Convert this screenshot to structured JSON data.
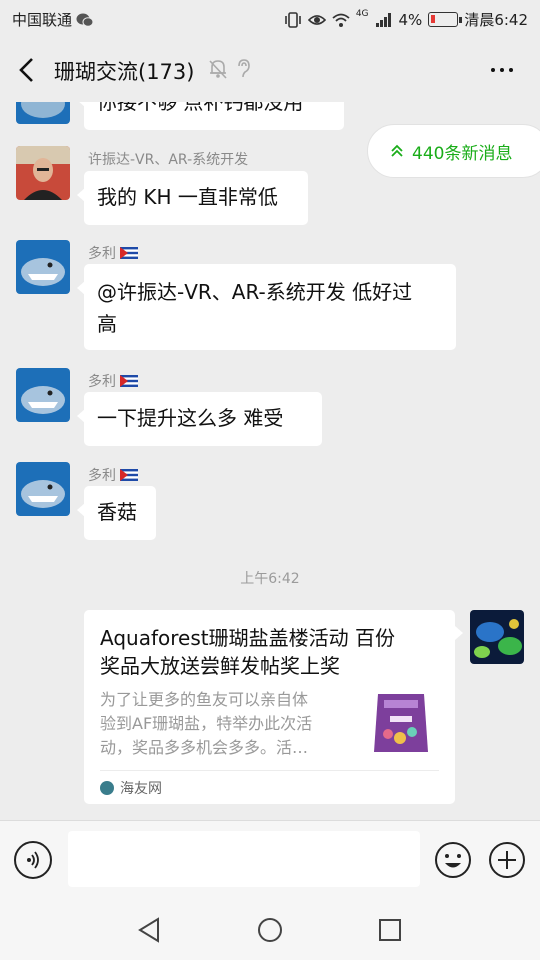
{
  "status_bar": {
    "carrier": "中国联通",
    "network": "4G",
    "battery": "4%",
    "time": "清晨6:42"
  },
  "nav": {
    "title": "珊瑚交流(173)"
  },
  "new_messages": {
    "label": "440条新消息"
  },
  "messages": [
    {
      "text": "你接不够 点补钙都没用"
    },
    {
      "sender": "许振达-VR、AR-系统开发",
      "text": "我的 KH 一直非常低"
    },
    {
      "sender": "多利",
      "text_line1": "@许振达-VR、AR-系统开发  低好过",
      "text_line2": "高"
    },
    {
      "sender": "多利",
      "text": "一下提升这么多 难受"
    },
    {
      "sender": "多利",
      "text": "香菇"
    }
  ],
  "timestamp": "上午6:42",
  "link_card": {
    "title_line1": "Aquaforest珊瑚盐盖楼活动 百份",
    "title_line2": "奖品大放送尝鲜发帖奖上奖",
    "desc_line1": "为了让更多的鱼友可以亲自体",
    "desc_line2": "验到AF珊瑚盐，特举办此次活",
    "desc_line3": "动，奖品多多机会多多。活…",
    "source": "海友网"
  },
  "colors": {
    "accent_green": "#1aad19",
    "background": "#ededed",
    "bubble": "#ffffff"
  }
}
